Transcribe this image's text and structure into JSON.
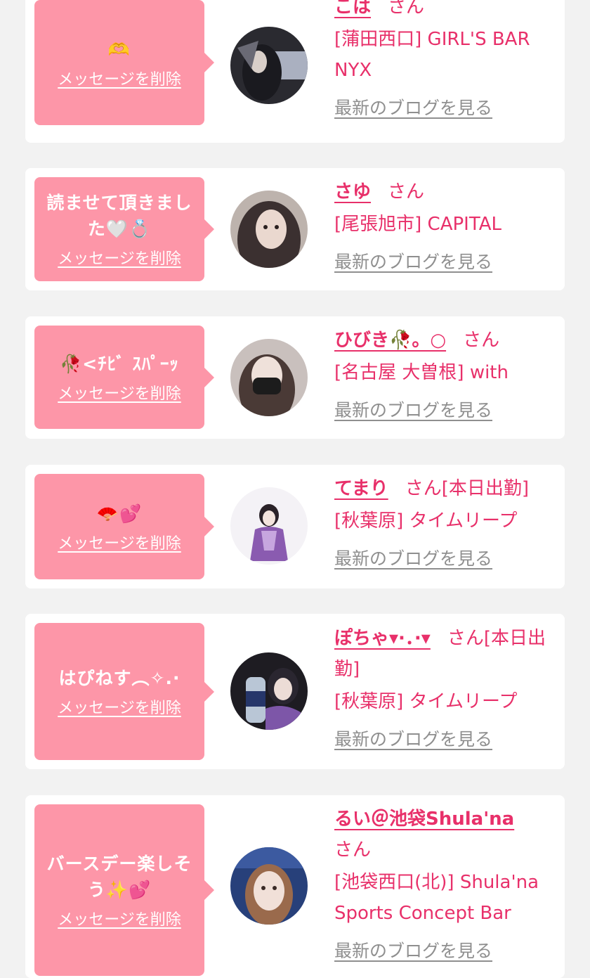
{
  "common": {
    "delete_label": "メッセージを削除",
    "san": "さん",
    "blog_label": "最新のブログを見る"
  },
  "items": [
    {
      "message_line1": "🫶",
      "message_line2": "",
      "name": "こは",
      "extra": "",
      "shop_line1": "[蒲田西口] GIRL'S BAR",
      "shop_line2": "NYX"
    },
    {
      "message_line1": "読ませて頂きまし",
      "message_line2": "た🤍💍",
      "name": "さゆ",
      "extra": "",
      "shop_line1": "[尾張旭市] CAPITAL",
      "shop_line2": ""
    },
    {
      "message_line1": "🥀<ﾁﾋﾞ ｽﾊﾟｰｯ",
      "message_line2": "",
      "name": "ひびき🥀。○",
      "extra": "",
      "shop_line1": "[名古屋 大曽根] with",
      "shop_line2": ""
    },
    {
      "message_line1": "🪭💕",
      "message_line2": "",
      "name": "てまり",
      "extra": "[本日出勤]",
      "shop_line1": "[秋葉原] タイムリープ",
      "shop_line2": ""
    },
    {
      "message_line1": "はぴねす︵✧.·",
      "message_line2": "",
      "name": "ぽちゃ▾·．·▾",
      "extra": "[本日出勤]",
      "shop_line1": "[秋葉原] タイムリープ",
      "shop_line2": ""
    },
    {
      "message_line1": "バースデー楽しそ",
      "message_line2": "う✨💕",
      "name": "るい＠池袋Shula'na",
      "extra": "",
      "shop_line1": "[池袋西口(北)] Shula'na",
      "shop_line2": "Sports Concept Bar"
    }
  ],
  "colors": {
    "accent": "#e8306a",
    "bubble": "#fd96a8",
    "background": "#f2f2f2",
    "link_gray": "#8f8f8f"
  }
}
